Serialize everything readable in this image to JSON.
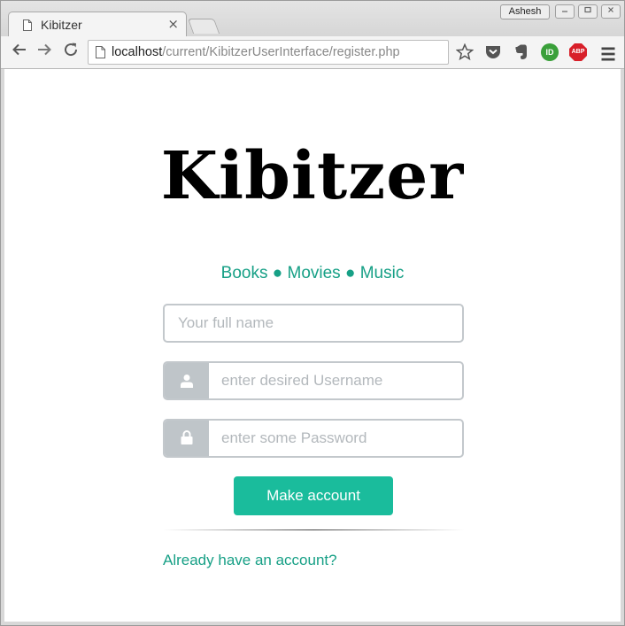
{
  "browser": {
    "tab_title": "Kibitzer",
    "tab_close": "×",
    "profile_name": "Ashesh",
    "url_host": "localhost",
    "url_path": "/current/KibitzerUserInterface/register.php",
    "icons": [
      "back-icon",
      "forward-icon",
      "reload-icon",
      "page-icon",
      "star-icon",
      "pocket-icon",
      "evernote-icon",
      "id-icon",
      "adblock-icon",
      "menu-icon"
    ],
    "adblock_label": "ABP",
    "id_label": "ID"
  },
  "page": {
    "logo": "Kibitzer",
    "tagline": "Books ● Movies ● Music",
    "fullname_placeholder": "Your full name",
    "username_placeholder": "enter desired Username",
    "password_placeholder": "enter some Password",
    "submit_label": "Make account",
    "login_link": "Already have an account?",
    "accent_color": "#1abc9c",
    "link_color": "#17a086"
  }
}
